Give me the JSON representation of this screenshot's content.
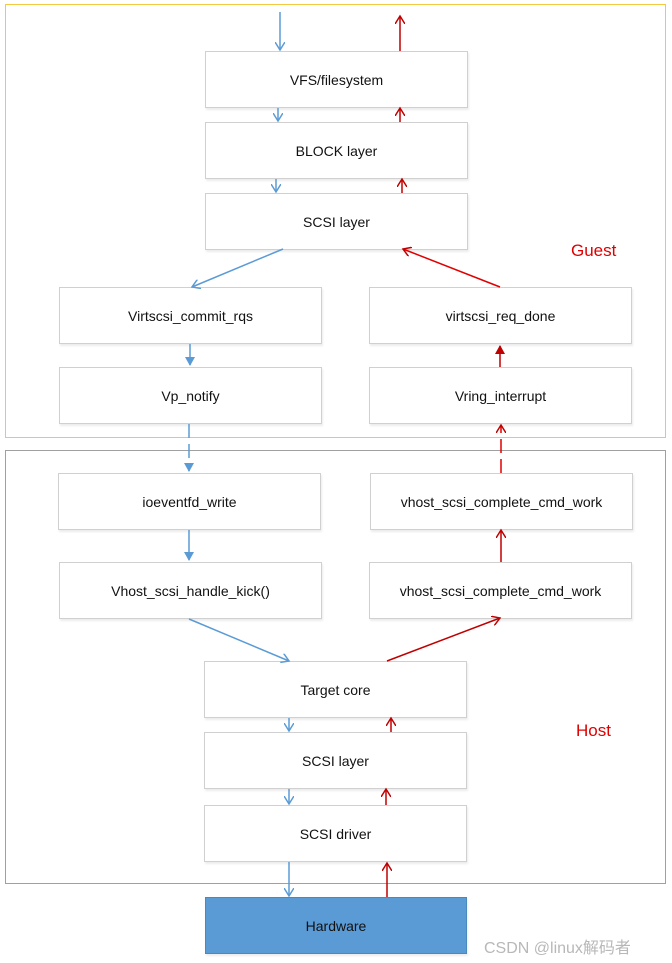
{
  "guest": {
    "label": "Guest",
    "frame_color": "#f5c842",
    "boxes": {
      "vfs": "VFS/filesystem",
      "block": "BLOCK layer",
      "scsi": "SCSI layer",
      "commit": "Virtscsi_commit_rqs",
      "req_done": "virtscsi_req_done",
      "vp_notify": "Vp_notify",
      "vring_interrupt": "Vring_interrupt"
    }
  },
  "host": {
    "label": "Host",
    "frame_color": "#a0a0a0",
    "boxes": {
      "ioeventfd": "ioeventfd_write",
      "complete_top": "vhost_scsi_complete_cmd_work",
      "handle_kick": "Vhost_scsi_handle_kick()",
      "complete_bottom": "vhost_scsi_complete_cmd_work",
      "target_core": "Target core",
      "scsi_layer": "SCSI layer",
      "scsi_driver": "SCSI driver"
    }
  },
  "hardware": {
    "label": "Hardware",
    "color": "#5b9bd5"
  },
  "colors": {
    "request_arrow": "#5b9bd5",
    "completion_arrow": "#c00000",
    "label": "#e00000"
  },
  "watermark": "CSDN @linux解码者"
}
